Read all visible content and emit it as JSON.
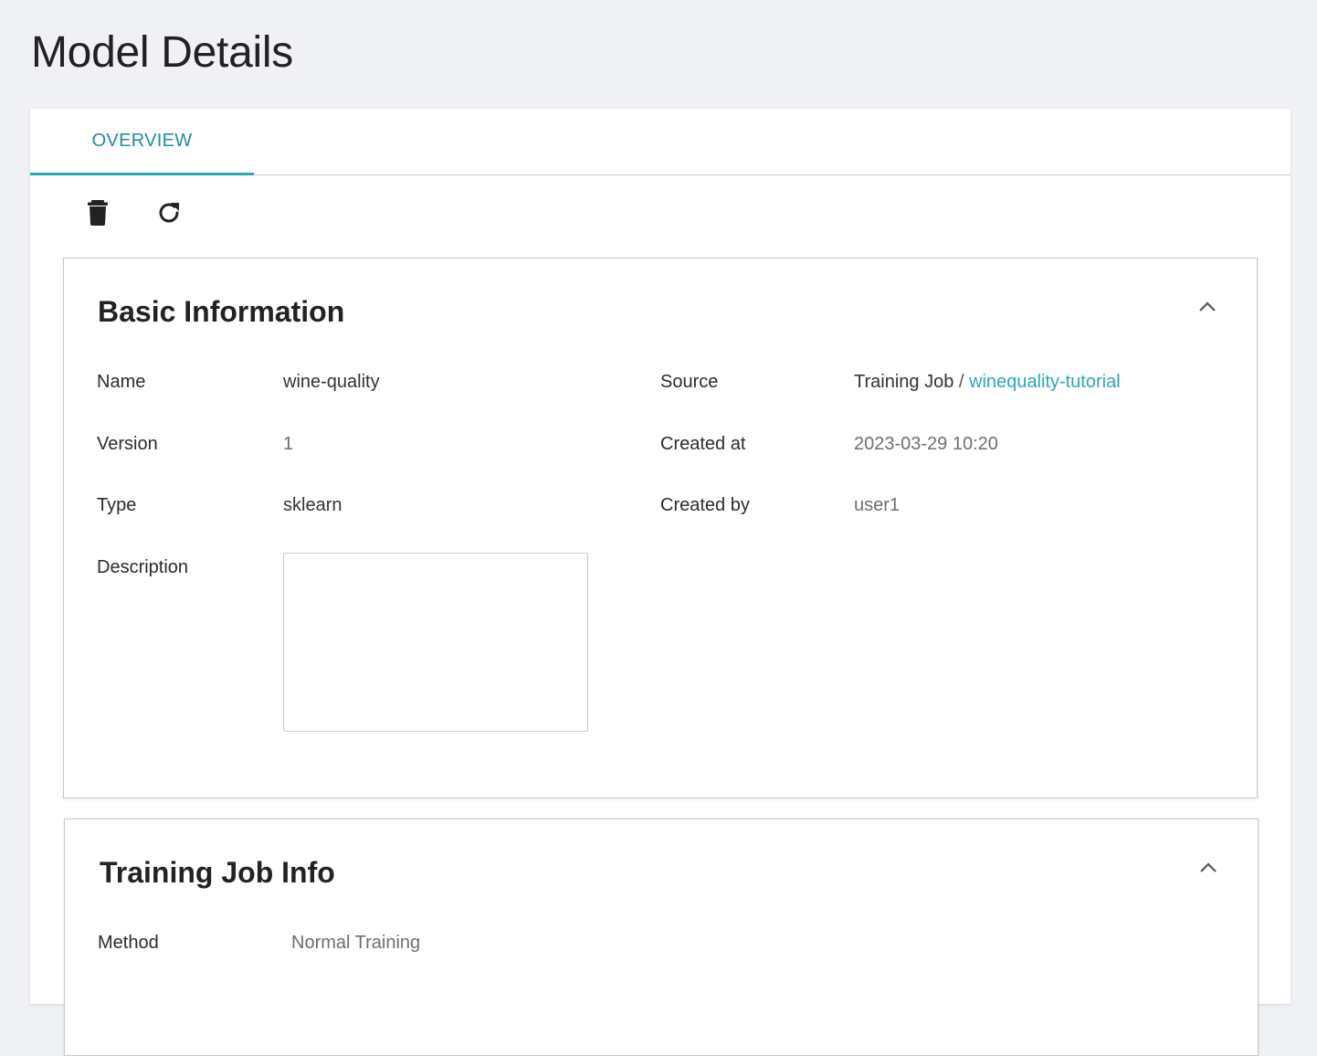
{
  "page": {
    "title": "Model Details"
  },
  "tabs": [
    {
      "label": "OVERVIEW",
      "active": true
    }
  ],
  "toolbar": {
    "delete_icon": "trash-icon",
    "refresh_icon": "refresh-icon"
  },
  "basic_info": {
    "title": "Basic Information",
    "fields": {
      "name": {
        "label": "Name",
        "value": "wine-quality"
      },
      "version": {
        "label": "Version",
        "value": "1"
      },
      "type": {
        "label": "Type",
        "value": "sklearn"
      },
      "description": {
        "label": "Description",
        "value": ""
      },
      "source": {
        "label": "Source",
        "prefix": "Training Job",
        "separator": "/",
        "link": "winequality-tutorial"
      },
      "created_at": {
        "label": "Created at",
        "value": "2023-03-29 10:20"
      },
      "created_by": {
        "label": "Created by",
        "value": "user1"
      }
    }
  },
  "training_job_info": {
    "title": "Training Job Info",
    "fields": {
      "method": {
        "label": "Method",
        "value": "Normal Training"
      }
    }
  },
  "colors": {
    "accent": "#2aa6bd",
    "background": "#f0f1f5",
    "muted_text": "#6f6f6f"
  }
}
